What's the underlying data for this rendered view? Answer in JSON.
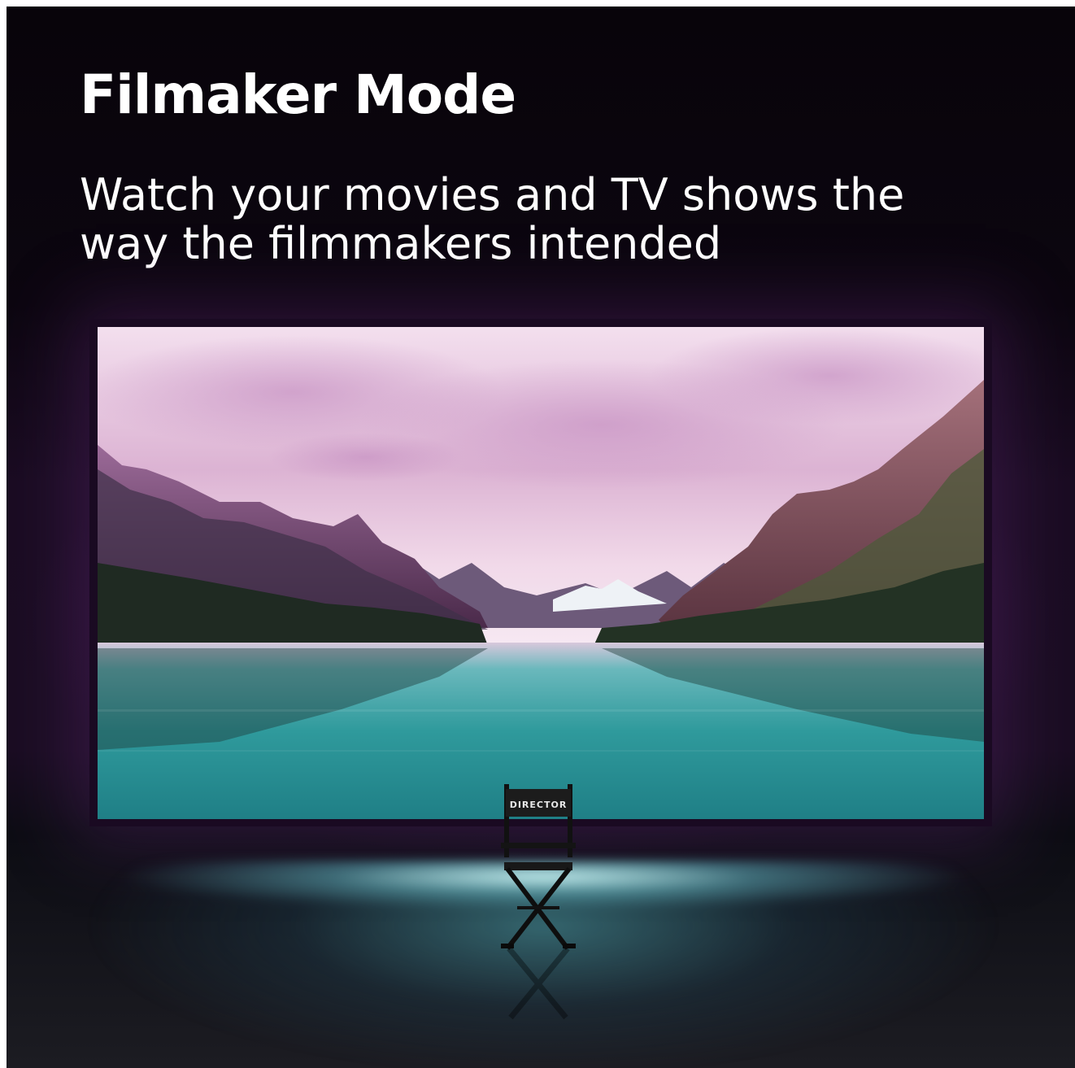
{
  "heading": "Filmaker Mode",
  "subheading": "Watch your movies and TV shows the way the filmmakers intended",
  "chair_label": "DIRECTOR",
  "colors": {
    "background": "#0c0610",
    "text": "#ffffff",
    "sky": "#e8c9dc",
    "water": "#3aa0a0"
  }
}
